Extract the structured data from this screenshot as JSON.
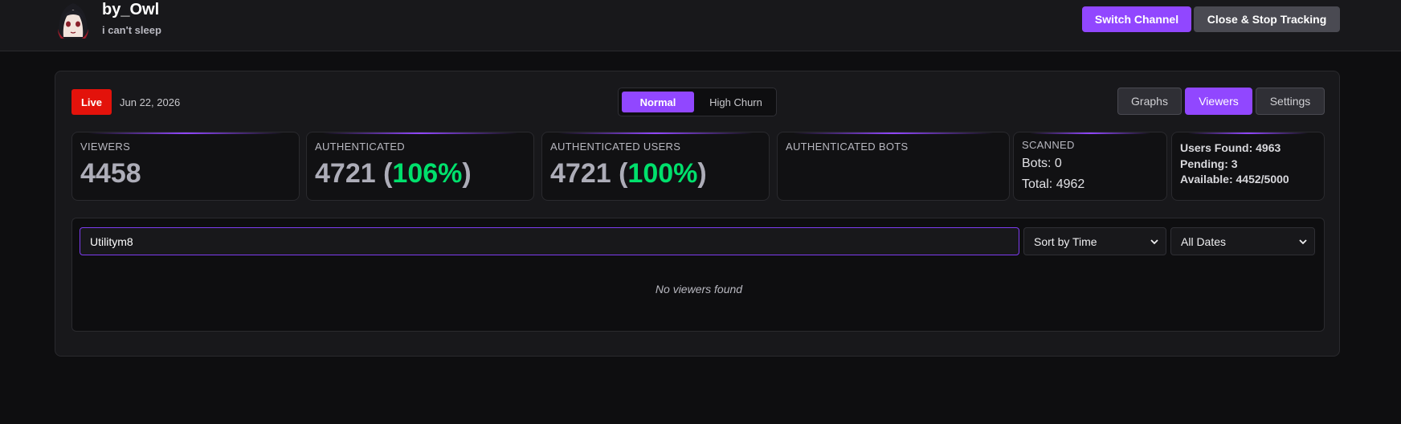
{
  "header": {
    "channel_name": "by_Owl",
    "status": "i can't sleep",
    "switch_label": "Switch Channel",
    "close_label": "Close & Stop Tracking"
  },
  "panel": {
    "live_label": "Live",
    "date": "Jun 22, 2026",
    "modes": {
      "normal": "Normal",
      "high_churn": "High Churn",
      "selected": "Normal"
    },
    "tabs": {
      "graphs": "Graphs",
      "viewers": "Viewers",
      "settings": "Settings",
      "active": "Viewers"
    }
  },
  "stats": {
    "viewers": {
      "label": "VIEWERS",
      "value": "4458"
    },
    "authenticated": {
      "label": "AUTHENTICATED",
      "value": "4721",
      "pct_open": "(",
      "pct": "106%",
      "pct_close": ")"
    },
    "authenticated_users": {
      "label": "AUTHENTICATED USERS",
      "value": "4721",
      "pct_open": "(",
      "pct": "100%",
      "pct_close": ")"
    },
    "authenticated_bots": {
      "label": "AUTHENTICATED BOTS"
    },
    "scanned": {
      "label": "SCANNED",
      "bots": "Bots: 0",
      "total": "Total: 4962"
    },
    "summary": {
      "users_found": "Users Found: 4963",
      "pending": "Pending: 3",
      "available": "Available: 4452/5000"
    }
  },
  "viewers_list": {
    "search_value": "Utilitym8",
    "sort_selected": "Sort by Time",
    "date_selected": "All Dates",
    "empty_message": "No viewers found"
  },
  "colors": {
    "accent": "#9147ff",
    "live": "#e3120b",
    "percent": "#00e06c",
    "background": "#0e0e10",
    "surface": "#18181b"
  },
  "icons": [
    "avatar-image",
    "chevron-down-icon"
  ]
}
